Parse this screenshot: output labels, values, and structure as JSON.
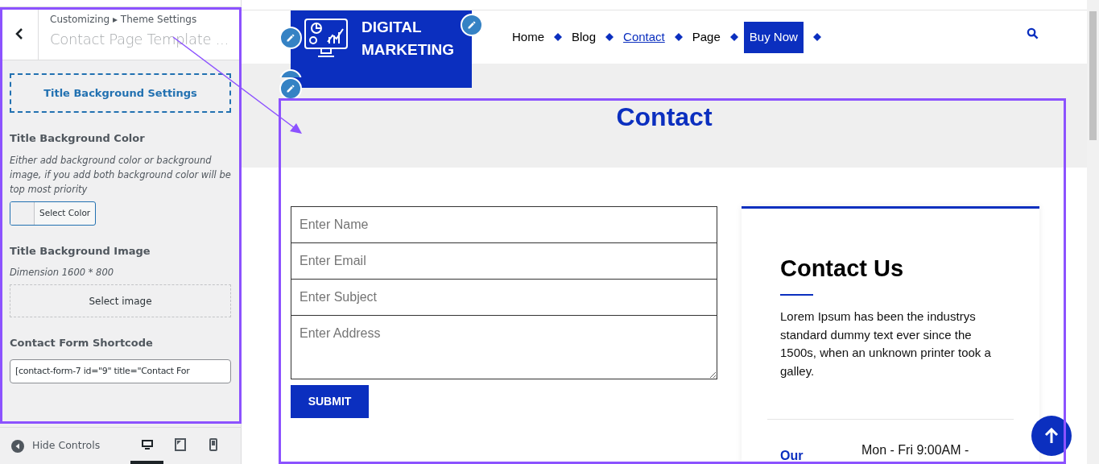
{
  "customizer": {
    "breadcrumb": "Customizing ▸ Theme Settings",
    "title": "Contact Page Template ...",
    "section_button": "Title Background Settings",
    "fields": [
      {
        "kind": "color",
        "label": "Title Background Color",
        "description": "Either add background color or background image, if you add both background color will be top most priority",
        "button": "Select Color"
      },
      {
        "kind": "image",
        "label": "Title Background Image",
        "description": "Dimension 1600 * 800",
        "button": "Select image"
      },
      {
        "kind": "text",
        "label": "Contact Form Shortcode",
        "value": "[contact-form-7 id=\"9\" title=\"Contact For"
      }
    ],
    "footer": {
      "hide_controls": "Hide Controls",
      "devices": [
        {
          "kind": "desktop",
          "selected": true
        },
        {
          "kind": "tablet",
          "selected": false
        },
        {
          "kind": "mobile",
          "selected": false
        }
      ]
    }
  },
  "preview": {
    "logo": {
      "line1": "DIGITAL",
      "line2": "MARKETING"
    },
    "nav": [
      {
        "label": "Home",
        "selected": false,
        "kind": "link"
      },
      {
        "label": "Blog",
        "selected": false,
        "kind": "link"
      },
      {
        "label": "Contact",
        "selected": true,
        "kind": "link"
      },
      {
        "label": "Page",
        "selected": false,
        "kind": "link"
      },
      {
        "label": "Buy Now",
        "selected": false,
        "kind": "button"
      }
    ],
    "page_title": "Contact",
    "form": {
      "fields": [
        {
          "kind": "input",
          "placeholder": "Enter Name"
        },
        {
          "kind": "input",
          "placeholder": "Enter Email"
        },
        {
          "kind": "input",
          "placeholder": "Enter Subject"
        },
        {
          "kind": "textarea",
          "placeholder": "Enter Address"
        }
      ],
      "submit": "SUBMIT"
    },
    "card": {
      "title": "Contact Us",
      "text": "Lorem Ipsum has been the industrys standard dummy text ever since the 1500s, when an unknown printer took a galley.",
      "label": "Our",
      "hours": "Mon - Fri 9:00AM -"
    }
  }
}
